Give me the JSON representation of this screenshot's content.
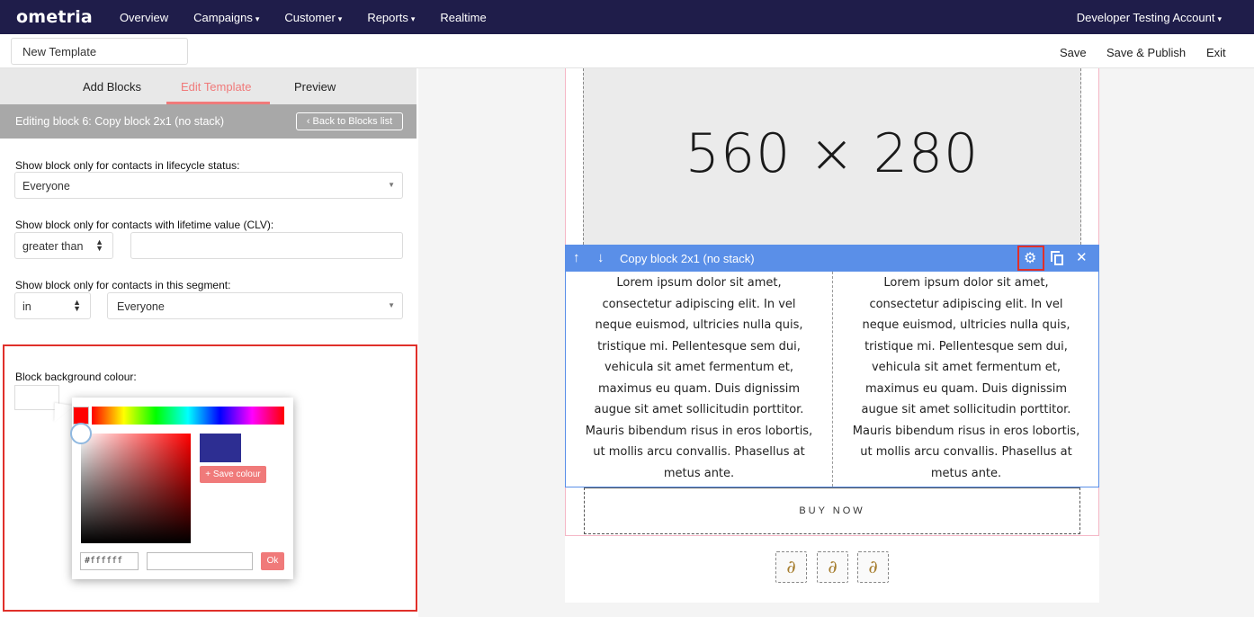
{
  "topnav": {
    "logo": "ometria",
    "items": [
      "Overview",
      "Campaigns",
      "Customer",
      "Reports",
      "Realtime"
    ],
    "account": "Developer Testing Account"
  },
  "subbar": {
    "template_name": "New Template",
    "save": "Save",
    "save_publish": "Save & Publish",
    "exit": "Exit"
  },
  "tabs": [
    "Add Blocks",
    "Edit Template",
    "Preview"
  ],
  "editbar": {
    "title": "Editing block 6: Copy block 2x1 (no stack)",
    "back": "‹ Back to Blocks list"
  },
  "form": {
    "lifecycle_label": "Show block only for contacts in lifecycle status:",
    "lifecycle_value": "Everyone",
    "clv_label": "Show block only for contacts with lifetime value (CLV):",
    "clv_operator": "greater than",
    "clv_value": "",
    "segment_label": "Show block only for contacts in this segment:",
    "segment_operator": "in",
    "segment_value": "Everyone",
    "bg_label": "Block background colour:"
  },
  "picker": {
    "save_colour": "+ Save colour",
    "hex": "#ffffff",
    "ok": "Ok",
    "preview_color": "#2d2e92"
  },
  "canvas": {
    "placeholder": "560 × 280",
    "block_title": "Copy block 2x1 (no stack)",
    "col_left": [
      "Lorem ipsum dolor sit amet,",
      "consectetur adipiscing elit. In vel",
      "neque euismod, ultricies nulla quis,",
      "tristique mi. Pellentesque sem dui,",
      "vehicula sit amet fermentum et,",
      "maximus eu quam. Duis dignissim",
      "augue sit amet sollicitudin porttitor.",
      "Mauris bibendum risus in eros lobortis,",
      "ut mollis arcu convallis. Phasellus at",
      "metus ante."
    ],
    "col_right": [
      "Lorem ipsum dolor sit amet,",
      "consectetur adipiscing elit. In vel",
      "neque euismod, ultricies nulla quis,",
      "tristique mi. Pellentesque sem dui,",
      "vehicula sit amet fermentum et,",
      "maximus eu quam. Duis dignissim",
      "augue sit amet sollicitudin porttitor.",
      "Mauris bibendum risus in eros lobortis,",
      "ut mollis arcu convallis. Phasellus at",
      "metus ante."
    ],
    "buy_now": "BUY NOW"
  },
  "colors": {
    "nav_bg": "#1f1d4a",
    "accent": "#f07a7a",
    "block_bar": "#5a8fe8",
    "highlight": "#e0302a"
  }
}
